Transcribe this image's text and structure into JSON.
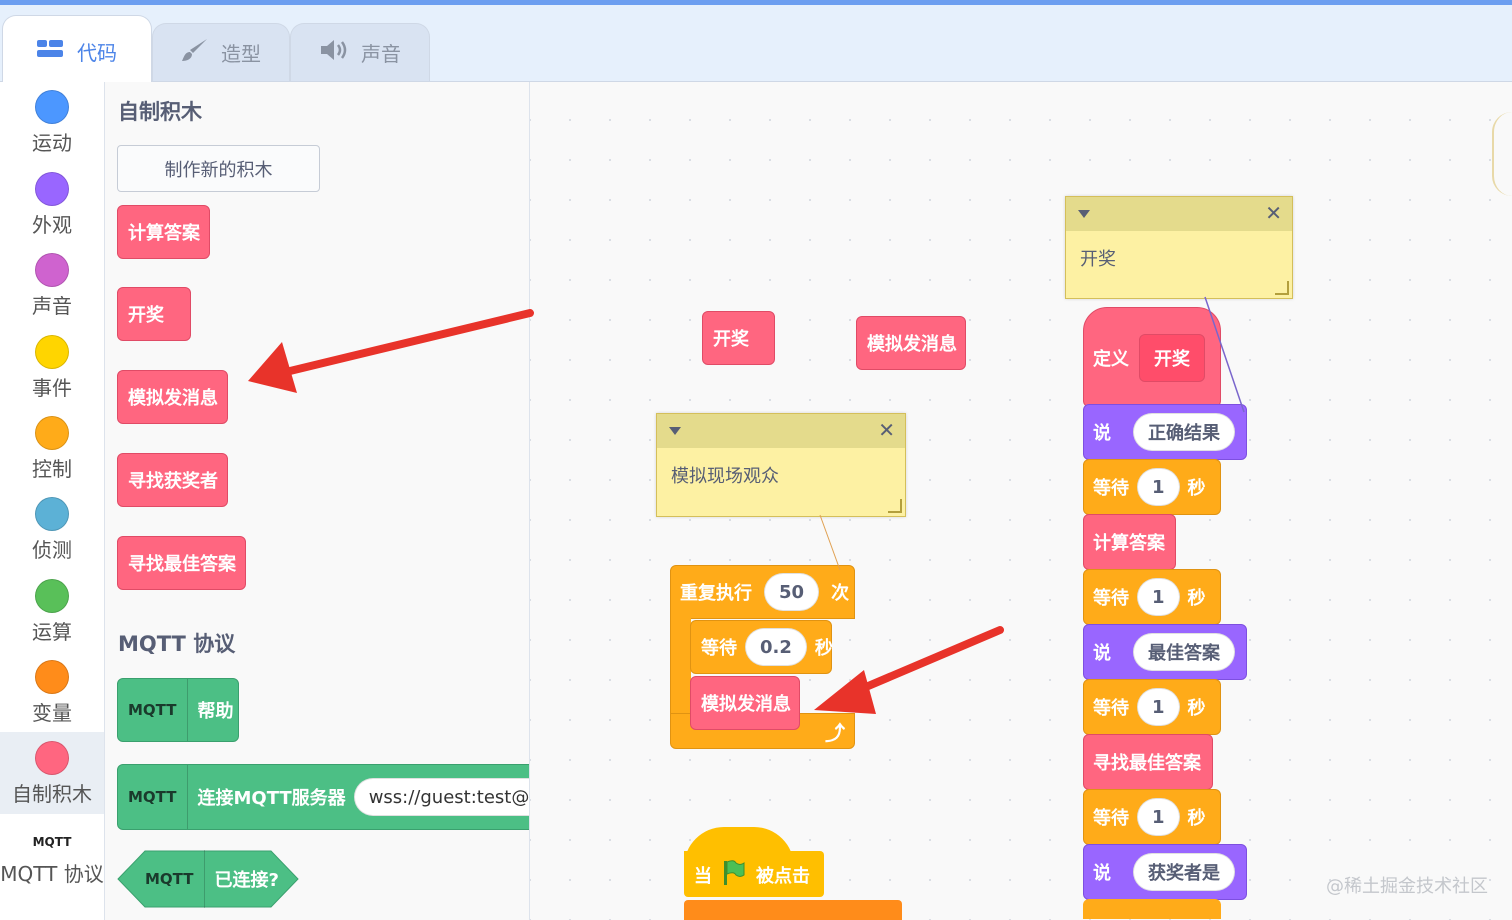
{
  "tabs": [
    {
      "label": "代码",
      "icon": "code-icon"
    },
    {
      "label": "造型",
      "icon": "brush-icon"
    },
    {
      "label": "声音",
      "icon": "speaker-icon"
    }
  ],
  "categories": [
    {
      "label": "运动",
      "color": "#4c97ff"
    },
    {
      "label": "外观",
      "color": "#9966ff"
    },
    {
      "label": "声音",
      "color": "#cf63cf"
    },
    {
      "label": "事件",
      "color": "#ffd500"
    },
    {
      "label": "控制",
      "color": "#ffab19"
    },
    {
      "label": "侦测",
      "color": "#5cb1d6"
    },
    {
      "label": "运算",
      "color": "#59c059"
    },
    {
      "label": "变量",
      "color": "#ff8c1a"
    },
    {
      "label": "自制积木",
      "color": "#ff6680"
    },
    {
      "label": "MQTT 协议",
      "logo": "MQTT"
    }
  ],
  "palette": {
    "my_blocks_title": "自制积木",
    "make_block_button": "制作新的积木",
    "my_blocks": [
      "计算答案",
      "开奖",
      "模拟发消息",
      "寻找获奖者",
      "寻找最佳答案"
    ],
    "mqtt_title": "MQTT 协议",
    "mqtt_logo": "MQTT",
    "mqtt_help": "帮助",
    "mqtt_connect": "连接MQTT服务器",
    "mqtt_server_value": "wss://guest:test@m",
    "mqtt_connected": "已连接?"
  },
  "workspace": {
    "loose_blocks": [
      "开奖",
      "模拟发消息"
    ],
    "comment_1": "模拟现场观众",
    "comment_2": "开奖",
    "repeat": {
      "label": "重复执行",
      "count": "50",
      "unit": "次"
    },
    "wait": {
      "label": "等待",
      "value": "0.2",
      "unit": "秒"
    },
    "inner_call": "模拟发消息",
    "hat": {
      "when": "当",
      "clicked": "被点击"
    },
    "define": {
      "label": "定义",
      "name": "开奖"
    },
    "script": [
      {
        "type": "say",
        "label": "说",
        "value": "正确结果"
      },
      {
        "type": "wait",
        "label": "等待",
        "value": "1",
        "unit": "秒"
      },
      {
        "type": "call",
        "label": "计算答案"
      },
      {
        "type": "wait",
        "label": "等待",
        "value": "1",
        "unit": "秒"
      },
      {
        "type": "say",
        "label": "说",
        "value": "最佳答案"
      },
      {
        "type": "wait",
        "label": "等待",
        "value": "1",
        "unit": "秒"
      },
      {
        "type": "call",
        "label": "寻找最佳答案"
      },
      {
        "type": "wait",
        "label": "等待",
        "value": "1",
        "unit": "秒"
      },
      {
        "type": "say",
        "label": "说",
        "value": "获奖者是"
      }
    ]
  },
  "watermark": "@稀土掘金技术社区"
}
